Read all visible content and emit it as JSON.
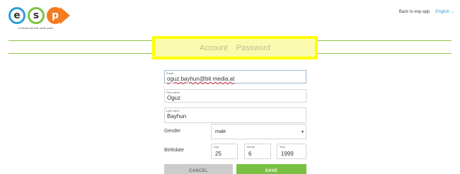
{
  "logo": {
    "letters": [
      "e",
      "s",
      "p"
    ],
    "tagline": "entrepreneurial skills pass"
  },
  "header": {
    "back_link": "Back to esp-app",
    "language": "English"
  },
  "tabs": [
    {
      "label": "Account"
    },
    {
      "label": "Password"
    }
  ],
  "form": {
    "email": {
      "label": "Email",
      "value": "oguz.bayhun@bit media.at"
    },
    "first_name": {
      "label": "First name",
      "value": "Oguz"
    },
    "last_name": {
      "label": "Last name",
      "value": "Bayhun"
    },
    "gender": {
      "label": "Gender",
      "selected": "male"
    },
    "birthdate": {
      "label": "Birthdate",
      "day": {
        "label": "Day",
        "value": "25"
      },
      "month": {
        "label": "Month",
        "value": "6"
      },
      "year": {
        "label": "Year",
        "value": "1999"
      }
    },
    "cancel_label": "CANCEL",
    "save_label": "SAVE"
  },
  "colors": {
    "accent_green": "#7ac143",
    "line_green": "#8cc63f",
    "highlight_yellow": "#ffff00",
    "logo_blue": "#2a9fd6",
    "logo_orange": "#f47b20"
  }
}
